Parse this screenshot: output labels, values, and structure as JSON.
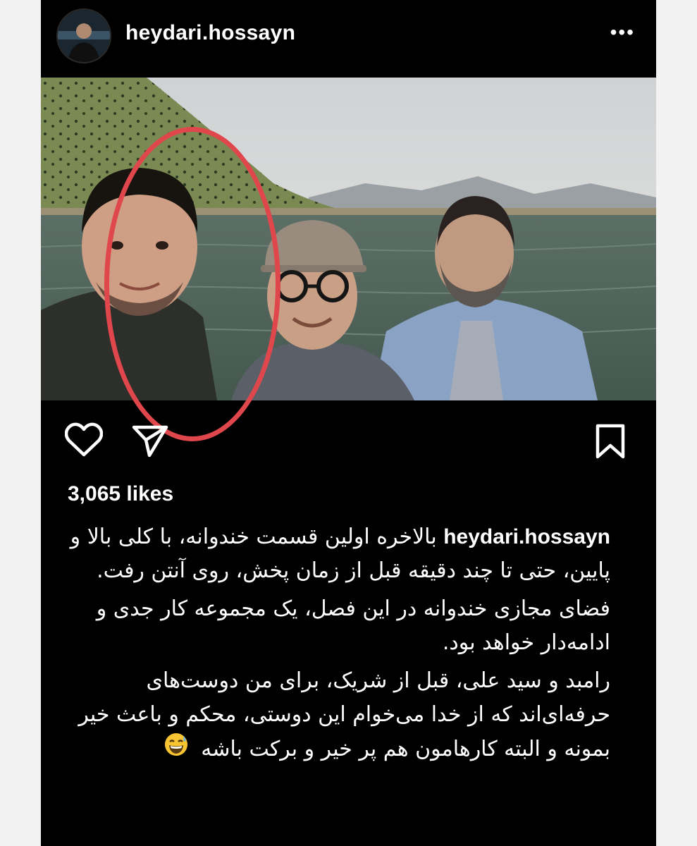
{
  "post": {
    "username": "heydari.hossayn",
    "more_icon": "more-dots-icon",
    "more_glyph": "•••",
    "likes": "3,065 likes",
    "caption": {
      "username": "heydari.hossayn",
      "p1": "بالاخره اولین قسمت خندوانه، با کلی بالا و پایین، حتی تا چند دقیقه قبل از زمان پخش، روی آنتن رفت.",
      "p2": "فضای مجازی خندوانه در این فصل، یک مجموعه کار جدی و ادامه‌دار خواهد بود.",
      "p3": "رامبد و سید علی، قبل از شریک، برای من دوست‌های حرفه‌ای‌اند که از خدا می‌خوام این دوستی، محکم و باعث خیر بمونه و البته کارهامون هم پر خیر و برکت باشه",
      "emoji": "grinning-face-with-sweat"
    },
    "actions": {
      "like_icon": "heart-icon",
      "share_icon": "send-icon",
      "save_icon": "bookmark-icon"
    },
    "colors": {
      "background": "#000000",
      "highlight_circle": "#e0474c"
    }
  }
}
